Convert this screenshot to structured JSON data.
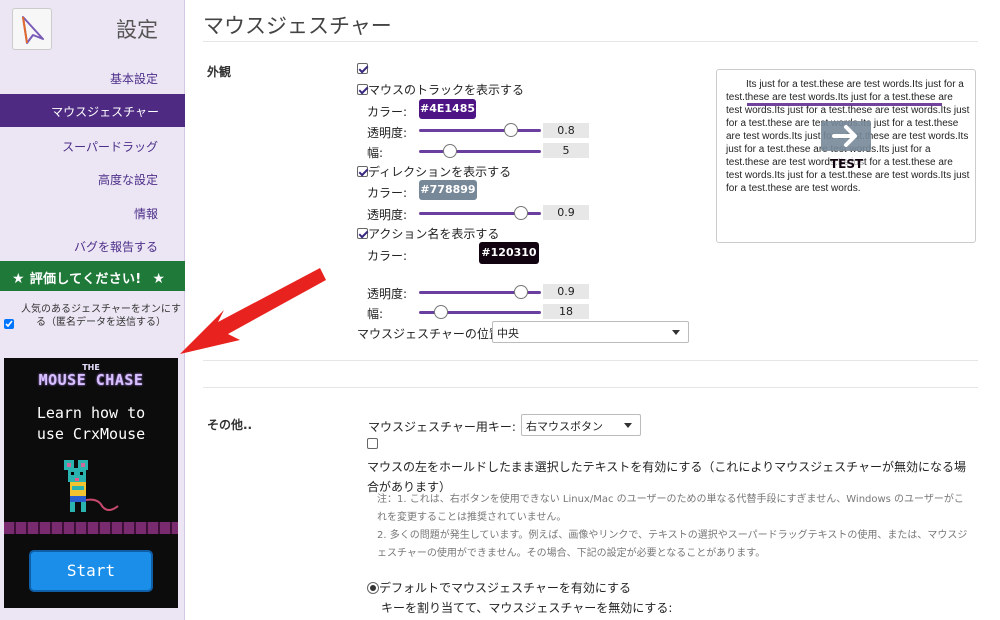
{
  "sidebar": {
    "title": "設定",
    "nav": {
      "basic": "基本設定",
      "mouse_gesture": "マウスジェスチャー",
      "super_drag": "スーパードラッグ",
      "advanced": "高度な設定",
      "info": "情報",
      "report_bug": "バグを報告する"
    },
    "rate": "評価してください!",
    "popular_label": "人気のあるジェスチャーをオンにする（匿名データを送信する）",
    "ad": {
      "the": "THE",
      "title": "MOUSE CHASE",
      "subtitle_line1": "Learn how to",
      "subtitle_line2": "use CrxMouse",
      "start": "Start"
    }
  },
  "main": {
    "title": "マウスジェスチャー",
    "appearance": {
      "label": "外観",
      "show_track": "マウスのトラックを表示する",
      "color_label": "カラー:",
      "opacity_label": "透明度:",
      "width_label": "幅:",
      "track_color": "#4E1485",
      "track_opacity": "0.8",
      "track_width": "5",
      "show_direction": "ディレクションを表示する",
      "direction_color": "#778899",
      "direction_opacity": "0.9",
      "show_action": "アクション名を表示する",
      "action_color": "#120310",
      "action_opacity": "0.9",
      "action_width": "18",
      "position_label": "マウスジェスチャーの位置",
      "position_value": "中央",
      "preview_text": "Its just for a test.these are test words.Its just for a test.these are test words.Its just for a test.these are test words.Its just for a test.these are test words.Its just for a test.these are test words.Its just for a test.these are test words.Its just for a test.these are test words.Its just for a test.these are test words.Its just for a test.these are test words.Its just for a test.these are test words.Its just for a test.these are test words.Its just for a test.these are test words.",
      "preview_label": "TEST"
    },
    "other": {
      "label": "その他..",
      "key_label": "マウスジェスチャー用キー:",
      "key_value": "右マウスボタン",
      "left_hold_text": "マウスの左をホールドしたまま選択したテキストを有効にする（これによりマウスジェスチャーが無効になる場合があります）",
      "note1": "注：1. これは、右ボタンを使用できない Linux/Mac のユーザーのための単なる代替手段にすぎません、Windows のユーザーがこれを変更することは推奨されていません。",
      "note2": "2. 多くの問題が発生しています。例えば、画像やリンクで、テキストの選択やスーパードラッグテキストの使用、または、マウスジェスチャーの使用ができません。その場合、下記の設定が必要となることがあります。",
      "default_enable": "デフォルトでマウスジェスチャーを有効にする",
      "assign_key": "キーを割り当てて、マウスジェスチャーを無効にする:"
    }
  },
  "colors": {
    "accent": "#4e2a83",
    "rate_bg": "#1f7a3a",
    "slider_track": "#6b3fa0"
  }
}
